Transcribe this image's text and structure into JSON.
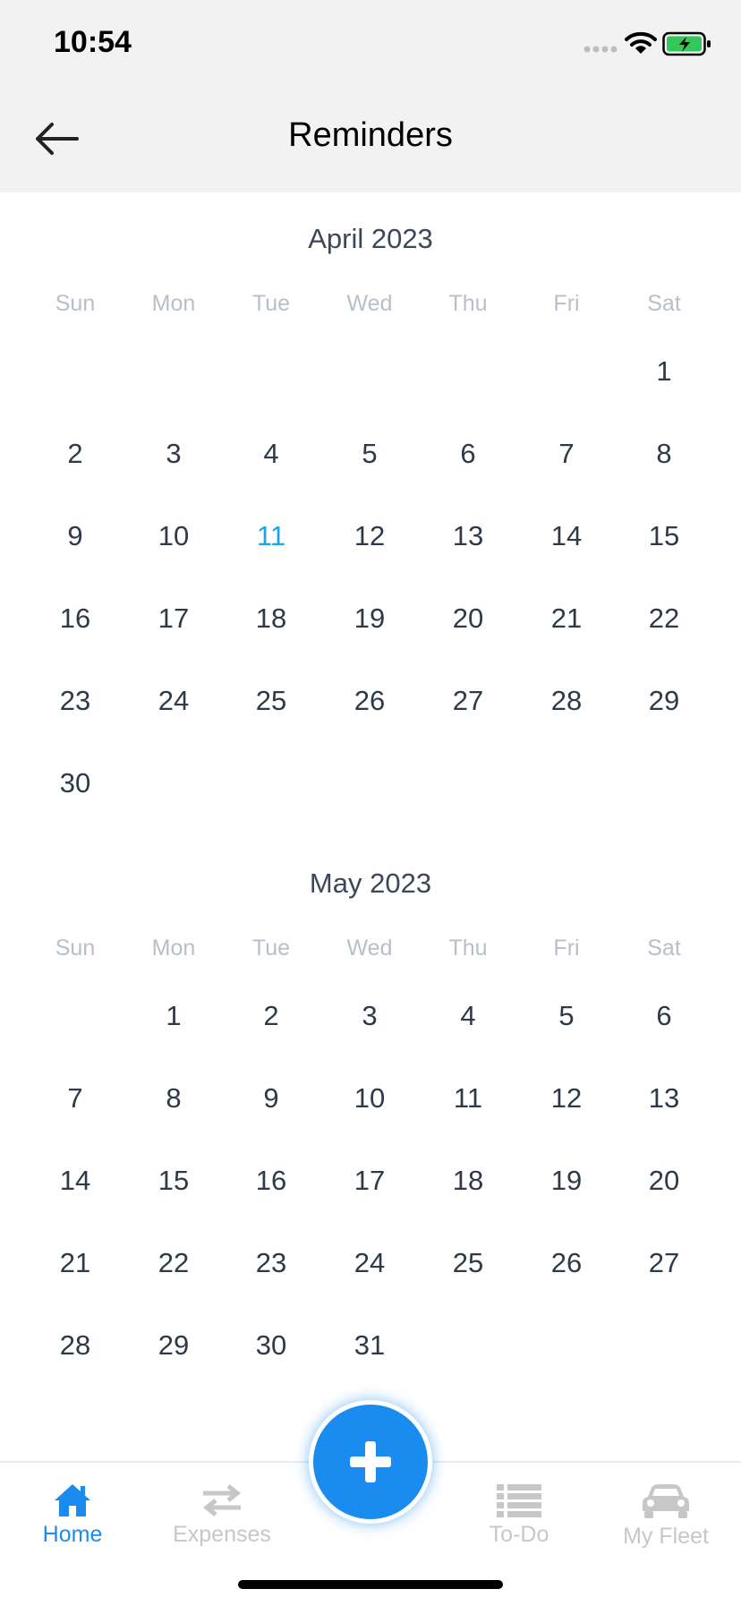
{
  "status": {
    "time": "10:54"
  },
  "header": {
    "title": "Reminders"
  },
  "weekdays": [
    "Sun",
    "Mon",
    "Tue",
    "Wed",
    "Thu",
    "Fri",
    "Sat"
  ],
  "april": {
    "title": "April 2023",
    "days": [
      "1",
      "2",
      "3",
      "4",
      "5",
      "6",
      "7",
      "8",
      "9",
      "10",
      "11",
      "12",
      "13",
      "14",
      "15",
      "16",
      "17",
      "18",
      "19",
      "20",
      "21",
      "22",
      "23",
      "24",
      "25",
      "26",
      "27",
      "28",
      "29",
      "30"
    ]
  },
  "may": {
    "title": "May 2023",
    "days": [
      "1",
      "2",
      "3",
      "4",
      "5",
      "6",
      "7",
      "8",
      "9",
      "10",
      "11",
      "12",
      "13",
      "14",
      "15",
      "16",
      "17",
      "18",
      "19",
      "20",
      "21",
      "22",
      "23",
      "24",
      "25",
      "26",
      "27",
      "28",
      "29",
      "30",
      "31"
    ]
  },
  "tabs": {
    "home": "Home",
    "expenses": "Expenses",
    "todo": "To-Do",
    "fleet": "My Fleet"
  },
  "colors": {
    "accent": "#1a8cf0",
    "today": "#1aa6e6",
    "inactive": "#c7c7c7",
    "weekday": "#b7bfcb"
  }
}
